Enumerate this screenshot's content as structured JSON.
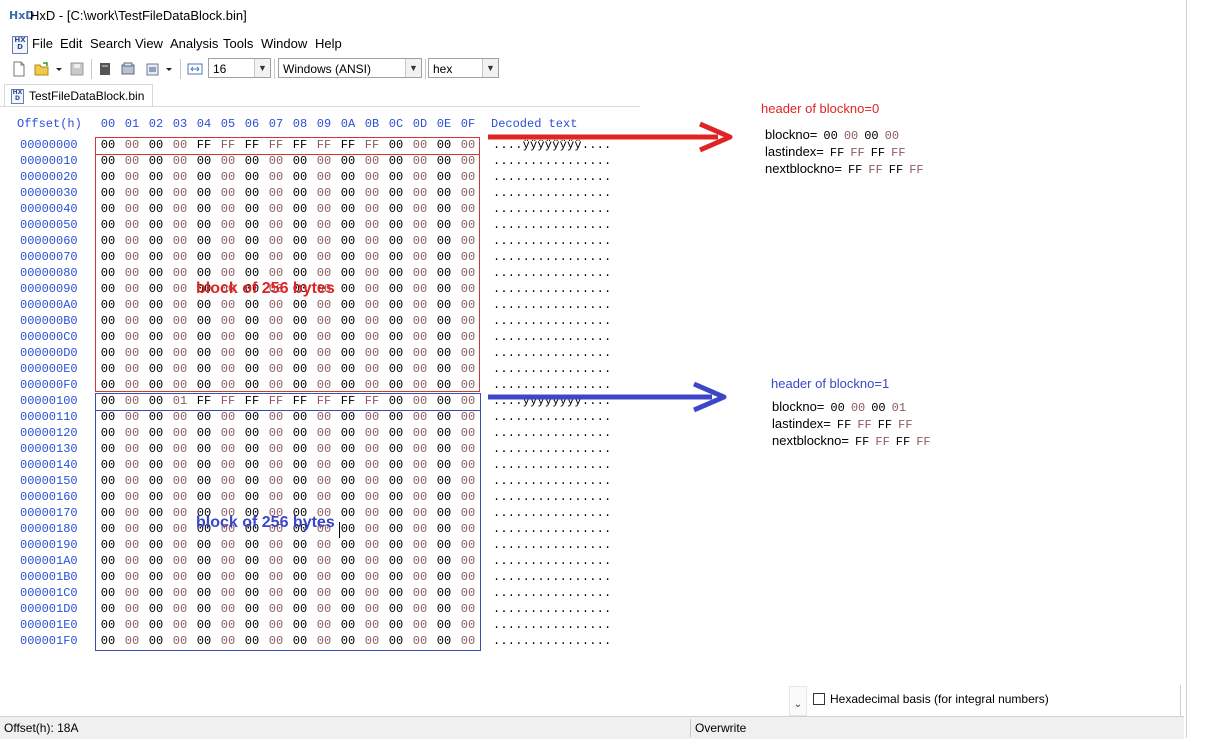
{
  "window": {
    "app_icon": "HxD",
    "title": "HxD - [C:\\work\\TestFileDataBlock.bin]"
  },
  "menu": {
    "icon": "hxd-doc-icon",
    "items": [
      "File",
      "Edit",
      "Search",
      "View",
      "Analysis",
      "Tools",
      "Window",
      "Help"
    ]
  },
  "toolbar": {
    "bytes_per_row": "16",
    "charset": "Windows (ANSI)",
    "display_mode": "hex"
  },
  "tab": {
    "label": "TestFileDataBlock.bin"
  },
  "hex": {
    "offset_header": "Offset(h)",
    "column_headers": [
      "00",
      "01",
      "02",
      "03",
      "04",
      "05",
      "06",
      "07",
      "08",
      "09",
      "0A",
      "0B",
      "0C",
      "0D",
      "0E",
      "0F"
    ],
    "decoded_header": "Decoded text",
    "rows": [
      {
        "offset": "00000000",
        "bytes": [
          "00",
          "00",
          "00",
          "00",
          "FF",
          "FF",
          "FF",
          "FF",
          "FF",
          "FF",
          "FF",
          "FF",
          "00",
          "00",
          "00",
          "00"
        ],
        "decoded": "....ÿÿÿÿÿÿÿÿ...."
      },
      {
        "offset": "00000010",
        "bytes": [
          "00",
          "00",
          "00",
          "00",
          "00",
          "00",
          "00",
          "00",
          "00",
          "00",
          "00",
          "00",
          "00",
          "00",
          "00",
          "00"
        ],
        "decoded": "................"
      },
      {
        "offset": "00000020",
        "bytes": [
          "00",
          "00",
          "00",
          "00",
          "00",
          "00",
          "00",
          "00",
          "00",
          "00",
          "00",
          "00",
          "00",
          "00",
          "00",
          "00"
        ],
        "decoded": "................"
      },
      {
        "offset": "00000030",
        "bytes": [
          "00",
          "00",
          "00",
          "00",
          "00",
          "00",
          "00",
          "00",
          "00",
          "00",
          "00",
          "00",
          "00",
          "00",
          "00",
          "00"
        ],
        "decoded": "................"
      },
      {
        "offset": "00000040",
        "bytes": [
          "00",
          "00",
          "00",
          "00",
          "00",
          "00",
          "00",
          "00",
          "00",
          "00",
          "00",
          "00",
          "00",
          "00",
          "00",
          "00"
        ],
        "decoded": "................"
      },
      {
        "offset": "00000050",
        "bytes": [
          "00",
          "00",
          "00",
          "00",
          "00",
          "00",
          "00",
          "00",
          "00",
          "00",
          "00",
          "00",
          "00",
          "00",
          "00",
          "00"
        ],
        "decoded": "................"
      },
      {
        "offset": "00000060",
        "bytes": [
          "00",
          "00",
          "00",
          "00",
          "00",
          "00",
          "00",
          "00",
          "00",
          "00",
          "00",
          "00",
          "00",
          "00",
          "00",
          "00"
        ],
        "decoded": "................"
      },
      {
        "offset": "00000070",
        "bytes": [
          "00",
          "00",
          "00",
          "00",
          "00",
          "00",
          "00",
          "00",
          "00",
          "00",
          "00",
          "00",
          "00",
          "00",
          "00",
          "00"
        ],
        "decoded": "................"
      },
      {
        "offset": "00000080",
        "bytes": [
          "00",
          "00",
          "00",
          "00",
          "00",
          "00",
          "00",
          "00",
          "00",
          "00",
          "00",
          "00",
          "00",
          "00",
          "00",
          "00"
        ],
        "decoded": "................"
      },
      {
        "offset": "00000090",
        "bytes": [
          "00",
          "00",
          "00",
          "00",
          "00",
          "00",
          "00",
          "00",
          "00",
          "00",
          "00",
          "00",
          "00",
          "00",
          "00",
          "00"
        ],
        "decoded": "................"
      },
      {
        "offset": "000000A0",
        "bytes": [
          "00",
          "00",
          "00",
          "00",
          "00",
          "00",
          "00",
          "00",
          "00",
          "00",
          "00",
          "00",
          "00",
          "00",
          "00",
          "00"
        ],
        "decoded": "................"
      },
      {
        "offset": "000000B0",
        "bytes": [
          "00",
          "00",
          "00",
          "00",
          "00",
          "00",
          "00",
          "00",
          "00",
          "00",
          "00",
          "00",
          "00",
          "00",
          "00",
          "00"
        ],
        "decoded": "................"
      },
      {
        "offset": "000000C0",
        "bytes": [
          "00",
          "00",
          "00",
          "00",
          "00",
          "00",
          "00",
          "00",
          "00",
          "00",
          "00",
          "00",
          "00",
          "00",
          "00",
          "00"
        ],
        "decoded": "................"
      },
      {
        "offset": "000000D0",
        "bytes": [
          "00",
          "00",
          "00",
          "00",
          "00",
          "00",
          "00",
          "00",
          "00",
          "00",
          "00",
          "00",
          "00",
          "00",
          "00",
          "00"
        ],
        "decoded": "................"
      },
      {
        "offset": "000000E0",
        "bytes": [
          "00",
          "00",
          "00",
          "00",
          "00",
          "00",
          "00",
          "00",
          "00",
          "00",
          "00",
          "00",
          "00",
          "00",
          "00",
          "00"
        ],
        "decoded": "................"
      },
      {
        "offset": "000000F0",
        "bytes": [
          "00",
          "00",
          "00",
          "00",
          "00",
          "00",
          "00",
          "00",
          "00",
          "00",
          "00",
          "00",
          "00",
          "00",
          "00",
          "00"
        ],
        "decoded": "................"
      },
      {
        "offset": "00000100",
        "bytes": [
          "00",
          "00",
          "00",
          "01",
          "FF",
          "FF",
          "FF",
          "FF",
          "FF",
          "FF",
          "FF",
          "FF",
          "00",
          "00",
          "00",
          "00"
        ],
        "decoded": "....ÿÿÿÿÿÿÿÿ...."
      },
      {
        "offset": "00000110",
        "bytes": [
          "00",
          "00",
          "00",
          "00",
          "00",
          "00",
          "00",
          "00",
          "00",
          "00",
          "00",
          "00",
          "00",
          "00",
          "00",
          "00"
        ],
        "decoded": "................"
      },
      {
        "offset": "00000120",
        "bytes": [
          "00",
          "00",
          "00",
          "00",
          "00",
          "00",
          "00",
          "00",
          "00",
          "00",
          "00",
          "00",
          "00",
          "00",
          "00",
          "00"
        ],
        "decoded": "................"
      },
      {
        "offset": "00000130",
        "bytes": [
          "00",
          "00",
          "00",
          "00",
          "00",
          "00",
          "00",
          "00",
          "00",
          "00",
          "00",
          "00",
          "00",
          "00",
          "00",
          "00"
        ],
        "decoded": "................"
      },
      {
        "offset": "00000140",
        "bytes": [
          "00",
          "00",
          "00",
          "00",
          "00",
          "00",
          "00",
          "00",
          "00",
          "00",
          "00",
          "00",
          "00",
          "00",
          "00",
          "00"
        ],
        "decoded": "................"
      },
      {
        "offset": "00000150",
        "bytes": [
          "00",
          "00",
          "00",
          "00",
          "00",
          "00",
          "00",
          "00",
          "00",
          "00",
          "00",
          "00",
          "00",
          "00",
          "00",
          "00"
        ],
        "decoded": "................"
      },
      {
        "offset": "00000160",
        "bytes": [
          "00",
          "00",
          "00",
          "00",
          "00",
          "00",
          "00",
          "00",
          "00",
          "00",
          "00",
          "00",
          "00",
          "00",
          "00",
          "00"
        ],
        "decoded": "................"
      },
      {
        "offset": "00000170",
        "bytes": [
          "00",
          "00",
          "00",
          "00",
          "00",
          "00",
          "00",
          "00",
          "00",
          "00",
          "00",
          "00",
          "00",
          "00",
          "00",
          "00"
        ],
        "decoded": "................"
      },
      {
        "offset": "00000180",
        "bytes": [
          "00",
          "00",
          "00",
          "00",
          "00",
          "00",
          "00",
          "00",
          "00",
          "00",
          "00",
          "00",
          "00",
          "00",
          "00",
          "00"
        ],
        "decoded": "................"
      },
      {
        "offset": "00000190",
        "bytes": [
          "00",
          "00",
          "00",
          "00",
          "00",
          "00",
          "00",
          "00",
          "00",
          "00",
          "00",
          "00",
          "00",
          "00",
          "00",
          "00"
        ],
        "decoded": "................"
      },
      {
        "offset": "000001A0",
        "bytes": [
          "00",
          "00",
          "00",
          "00",
          "00",
          "00",
          "00",
          "00",
          "00",
          "00",
          "00",
          "00",
          "00",
          "00",
          "00",
          "00"
        ],
        "decoded": "................"
      },
      {
        "offset": "000001B0",
        "bytes": [
          "00",
          "00",
          "00",
          "00",
          "00",
          "00",
          "00",
          "00",
          "00",
          "00",
          "00",
          "00",
          "00",
          "00",
          "00",
          "00"
        ],
        "decoded": "................"
      },
      {
        "offset": "000001C0",
        "bytes": [
          "00",
          "00",
          "00",
          "00",
          "00",
          "00",
          "00",
          "00",
          "00",
          "00",
          "00",
          "00",
          "00",
          "00",
          "00",
          "00"
        ],
        "decoded": "................"
      },
      {
        "offset": "000001D0",
        "bytes": [
          "00",
          "00",
          "00",
          "00",
          "00",
          "00",
          "00",
          "00",
          "00",
          "00",
          "00",
          "00",
          "00",
          "00",
          "00",
          "00"
        ],
        "decoded": "................"
      },
      {
        "offset": "000001E0",
        "bytes": [
          "00",
          "00",
          "00",
          "00",
          "00",
          "00",
          "00",
          "00",
          "00",
          "00",
          "00",
          "00",
          "00",
          "00",
          "00",
          "00"
        ],
        "decoded": "................"
      },
      {
        "offset": "000001F0",
        "bytes": [
          "00",
          "00",
          "00",
          "00",
          "00",
          "00",
          "00",
          "00",
          "00",
          "00",
          "00",
          "00",
          "00",
          "00",
          "00",
          "00"
        ],
        "decoded": "................"
      }
    ]
  },
  "annotations": {
    "block_label_1": "block of 256 bytes",
    "block_label_2": "block of 256 bytes",
    "header0": {
      "title": "header of blockno=0",
      "lines": [
        {
          "label": "blockno=",
          "values": [
            "00",
            "00",
            "00",
            "00"
          ]
        },
        {
          "label": "lastindex=",
          "values": [
            "FF",
            "FF",
            "FF",
            "FF"
          ]
        },
        {
          "label": "nextblockno=",
          "values": [
            "FF",
            "FF",
            "FF",
            "FF"
          ]
        }
      ]
    },
    "header1": {
      "title": "header of blockno=1",
      "lines": [
        {
          "label": "blockno=",
          "values": [
            "00",
            "00",
            "00",
            "01"
          ]
        },
        {
          "label": "lastindex=",
          "values": [
            "FF",
            "FF",
            "FF",
            "FF"
          ]
        },
        {
          "label": "nextblockno=",
          "values": [
            "FF",
            "FF",
            "FF",
            "FF"
          ]
        }
      ]
    },
    "colors": {
      "red": "#e02424",
      "blue": "#3b47c7"
    }
  },
  "side_panel": {
    "hex_basis_label": "Hexadecimal basis (for integral numbers)"
  },
  "status": {
    "offset": "Offset(h): 18A",
    "mode": "Overwrite"
  }
}
